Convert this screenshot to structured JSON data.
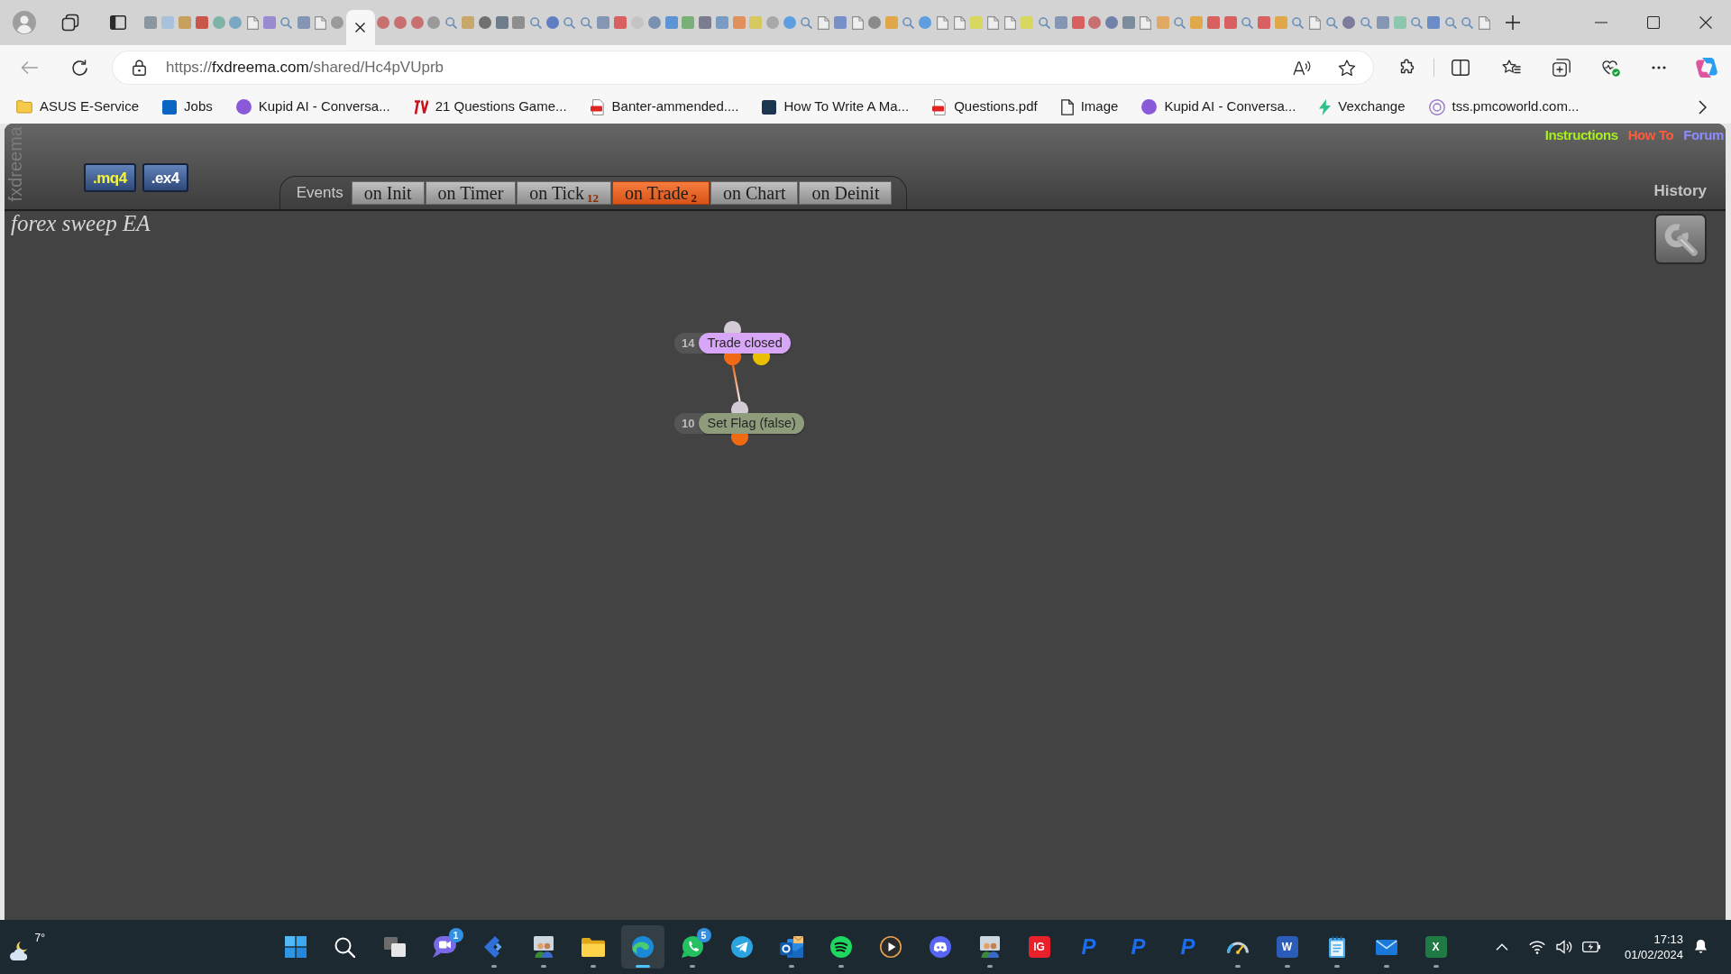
{
  "browser": {
    "tabs": [
      {
        "kind": "tile",
        "color": "#8a96a0",
        "selected": false
      },
      {
        "kind": "tile",
        "color": "#a9c2dc",
        "selected": false
      },
      {
        "kind": "tile",
        "color": "#c79f5e",
        "selected": false
      },
      {
        "kind": "tile",
        "color": "#c9564a",
        "selected": false
      },
      {
        "kind": "disc",
        "color": "#7fb3a6",
        "selected": false
      },
      {
        "kind": "disc",
        "color": "#7aa8c4",
        "selected": false
      },
      {
        "kind": "page",
        "selected": false
      },
      {
        "kind": "tile",
        "color": "#9a8ad0",
        "selected": false
      },
      {
        "kind": "search",
        "selected": false
      },
      {
        "kind": "tile",
        "color": "#8596b4",
        "selected": false
      },
      {
        "kind": "page",
        "selected": false
      },
      {
        "kind": "disc",
        "color": "#9a9a9a",
        "selected": false
      },
      {
        "selected": true
      },
      {
        "kind": "disc",
        "color": "#c87070",
        "selected": false
      },
      {
        "kind": "disc",
        "color": "#c87070",
        "selected": false
      },
      {
        "kind": "disc",
        "color": "#c87070",
        "selected": false
      },
      {
        "kind": "disc",
        "color": "#9a9a9a",
        "selected": false
      },
      {
        "kind": "search",
        "selected": false
      },
      {
        "kind": "tile",
        "color": "#c8a86a",
        "selected": false
      },
      {
        "kind": "disc",
        "color": "#707070",
        "selected": false
      },
      {
        "kind": "tile",
        "color": "#6e7c8c",
        "selected": false
      },
      {
        "kind": "tile",
        "color": "#8e8e8e",
        "selected": false
      },
      {
        "kind": "search",
        "selected": false
      },
      {
        "kind": "disc",
        "color": "#5f7ec4",
        "selected": false
      },
      {
        "kind": "search",
        "selected": false
      },
      {
        "kind": "search",
        "selected": false
      },
      {
        "kind": "tile",
        "color": "#8596b4",
        "selected": false
      },
      {
        "kind": "tile",
        "color": "#d86060",
        "selected": false
      },
      {
        "kind": "disc",
        "color": "#c4c4c4",
        "selected": false
      },
      {
        "kind": "disc",
        "color": "#7a92b0",
        "selected": false
      },
      {
        "kind": "tile",
        "color": "#5d94d6",
        "selected": false
      },
      {
        "kind": "tile",
        "color": "#78b078",
        "selected": false
      },
      {
        "kind": "tile",
        "color": "#7c7c90",
        "selected": false
      },
      {
        "kind": "tile",
        "color": "#7a9cc4",
        "selected": false
      },
      {
        "kind": "tile",
        "color": "#e0905a",
        "selected": false
      },
      {
        "kind": "tile",
        "color": "#d8c860",
        "selected": false
      },
      {
        "kind": "disc",
        "color": "#a8a8a8",
        "selected": false
      },
      {
        "kind": "disc",
        "color": "#5e9ee0",
        "selected": false
      },
      {
        "kind": "search",
        "selected": false
      },
      {
        "kind": "page",
        "selected": false
      },
      {
        "kind": "tile",
        "color": "#7890c8",
        "selected": false
      },
      {
        "kind": "page",
        "selected": false
      },
      {
        "kind": "disc",
        "color": "#8a8a8a",
        "selected": false
      },
      {
        "kind": "tile",
        "color": "#e0a84a",
        "selected": false
      },
      {
        "kind": "search",
        "selected": false
      },
      {
        "kind": "disc",
        "color": "#5e9ee0",
        "selected": false
      },
      {
        "kind": "page",
        "selected": false
      },
      {
        "kind": "page",
        "selected": false
      },
      {
        "kind": "tile",
        "color": "#d8d860",
        "selected": false
      },
      {
        "kind": "page",
        "selected": false
      },
      {
        "kind": "page",
        "selected": false
      },
      {
        "kind": "tile",
        "color": "#d8d860",
        "selected": false
      },
      {
        "kind": "search",
        "selected": false
      },
      {
        "kind": "tile",
        "color": "#8596b4",
        "selected": false
      },
      {
        "kind": "tile",
        "color": "#d86060",
        "selected": false
      },
      {
        "kind": "disc",
        "color": "#c87070",
        "selected": false
      },
      {
        "kind": "disc",
        "color": "#7080a8",
        "selected": false
      },
      {
        "kind": "tile",
        "color": "#7c8c9c",
        "selected": false
      },
      {
        "kind": "page",
        "selected": false
      },
      {
        "kind": "tile",
        "color": "#e0a860",
        "selected": false
      },
      {
        "kind": "search",
        "selected": false
      },
      {
        "kind": "tile",
        "color": "#e0a84a",
        "selected": false
      },
      {
        "kind": "tile",
        "color": "#d86060",
        "selected": false
      },
      {
        "kind": "tile",
        "color": "#d86060",
        "selected": false
      },
      {
        "kind": "search",
        "selected": false
      },
      {
        "kind": "tile",
        "color": "#d86060",
        "selected": false
      },
      {
        "kind": "tile",
        "color": "#e0a84a",
        "selected": false
      },
      {
        "kind": "search",
        "selected": false
      },
      {
        "kind": "page",
        "selected": false
      },
      {
        "kind": "search",
        "selected": false
      },
      {
        "kind": "disc",
        "color": "#7c7c9c",
        "selected": false
      },
      {
        "kind": "search",
        "selected": false
      },
      {
        "kind": "tile",
        "color": "#8596b4",
        "selected": false
      },
      {
        "kind": "tile",
        "color": "#8cc8b0",
        "selected": false
      },
      {
        "kind": "search",
        "selected": false
      },
      {
        "kind": "tile",
        "color": "#6c8cc8",
        "selected": false
      },
      {
        "kind": "search",
        "selected": false
      },
      {
        "kind": "search",
        "selected": false
      },
      {
        "kind": "page",
        "selected": false
      }
    ],
    "address": {
      "scheme": "https://",
      "host": "fxdreema.com",
      "path": "/shared/Hc4pVUprb"
    },
    "bookmarks": [
      {
        "kind": "folder",
        "label": "ASUS E-Service"
      },
      {
        "kind": "tile",
        "color": "#0a66c2",
        "label": "Jobs"
      },
      {
        "kind": "disc",
        "color": "#8a5ad8",
        "label": "Kupid AI - Conversa..."
      },
      {
        "kind": "mark",
        "color": "#c8141e",
        "label": "21 Questions Game..."
      },
      {
        "kind": "document",
        "label": "Banter-ammended...."
      },
      {
        "kind": "tile",
        "color": "#1c3550",
        "label": "How To Write A Ma..."
      },
      {
        "kind": "document",
        "label": "Questions.pdf"
      },
      {
        "kind": "page",
        "label": "Image"
      },
      {
        "kind": "disc",
        "color": "#8a5ad8",
        "label": "Kupid AI - Conversa..."
      },
      {
        "kind": "bolt",
        "color": "#2fc38a",
        "label": "Vexchange"
      },
      {
        "kind": "ring",
        "color": "#9a78c8",
        "label": "tss.pmcoworld.com..."
      }
    ]
  },
  "app": {
    "side_label": "fxdreema",
    "file_buttons": [
      {
        "label": ".mq4",
        "color": "#f4f43c"
      },
      {
        "label": ".ex4",
        "color": "#ffffff"
      }
    ],
    "events_label": "Events",
    "event_tabs": [
      {
        "label": "on Init",
        "selected": false
      },
      {
        "label": "on Timer",
        "selected": false
      },
      {
        "label": "on Tick",
        "count": "12",
        "selected": false
      },
      {
        "label": "on Trade",
        "count": "2",
        "selected": true
      },
      {
        "label": "on Chart",
        "selected": false
      },
      {
        "label": "on Deinit",
        "selected": false
      }
    ],
    "links": [
      {
        "label": "Instructions",
        "color": "#a6f01e"
      },
      {
        "label": "How To",
        "color": "#ff5a3a"
      },
      {
        "label": "Forum",
        "color": "#8c8cff"
      }
    ],
    "history_label": "History",
    "project_title": "forex sweep EA",
    "nodes": [
      {
        "number": "14",
        "label": "Trade closed",
        "color": "#d7a6f6",
        "outputs": [
          {
            "color": "#f06a14",
            "children": [
              {
                "number": "10",
                "label": "Set Flag (false)",
                "color": "#8e9c7c",
                "outputs": [
                  {
                    "color": "#f06a14"
                  }
                ]
              }
            ]
          },
          {
            "color": "#e8c000"
          }
        ]
      }
    ]
  },
  "taskbar": {
    "weather": {
      "temperature": "7°"
    },
    "apps": [
      {
        "kind": "start",
        "running": false,
        "selected": false
      },
      {
        "kind": "search",
        "running": false,
        "selected": false
      },
      {
        "kind": "taskview",
        "running": false,
        "selected": false
      },
      {
        "kind": "chat",
        "badge": "1",
        "running": false,
        "selected": false
      },
      {
        "kind": "arrow",
        "running": true,
        "selected": false
      },
      {
        "kind": "people",
        "running": true,
        "selected": false
      },
      {
        "kind": "folder",
        "running": true,
        "selected": false
      },
      {
        "kind": "browser",
        "running": true,
        "selected": true
      },
      {
        "kind": "phone",
        "badge": "5",
        "running": true,
        "selected": false
      },
      {
        "kind": "plane",
        "running": false,
        "selected": false
      },
      {
        "kind": "mailtile",
        "running": true,
        "selected": false
      },
      {
        "kind": "music",
        "running": true,
        "selected": false
      },
      {
        "kind": "play",
        "running": false,
        "selected": false
      },
      {
        "kind": "controller",
        "running": false,
        "selected": false
      },
      {
        "kind": "people",
        "running": true,
        "selected": false
      },
      {
        "kind": "letter",
        "label": "IG",
        "color": "#e8202a",
        "running": false,
        "selected": false
      },
      {
        "kind": "glyph",
        "label": "P",
        "color": "#1a6cf0",
        "running": false,
        "selected": false
      },
      {
        "kind": "glyph",
        "label": "P",
        "color": "#1a6cf0",
        "running": false,
        "selected": false
      },
      {
        "kind": "glyph",
        "label": "P",
        "color": "#1a6cf0",
        "running": false,
        "selected": false
      },
      {
        "kind": "gauge",
        "running": true,
        "selected": false
      },
      {
        "kind": "letter",
        "label": "W",
        "color": "#2b5cb8",
        "running": true,
        "selected": false
      },
      {
        "kind": "notepad",
        "running": true,
        "selected": false
      },
      {
        "kind": "envelope",
        "running": true,
        "selected": false
      },
      {
        "kind": "letter",
        "label": "X",
        "color": "#1f7a44",
        "running": true,
        "selected": false
      }
    ],
    "clock": {
      "time": "17:13",
      "date": "01/02/2024"
    }
  }
}
